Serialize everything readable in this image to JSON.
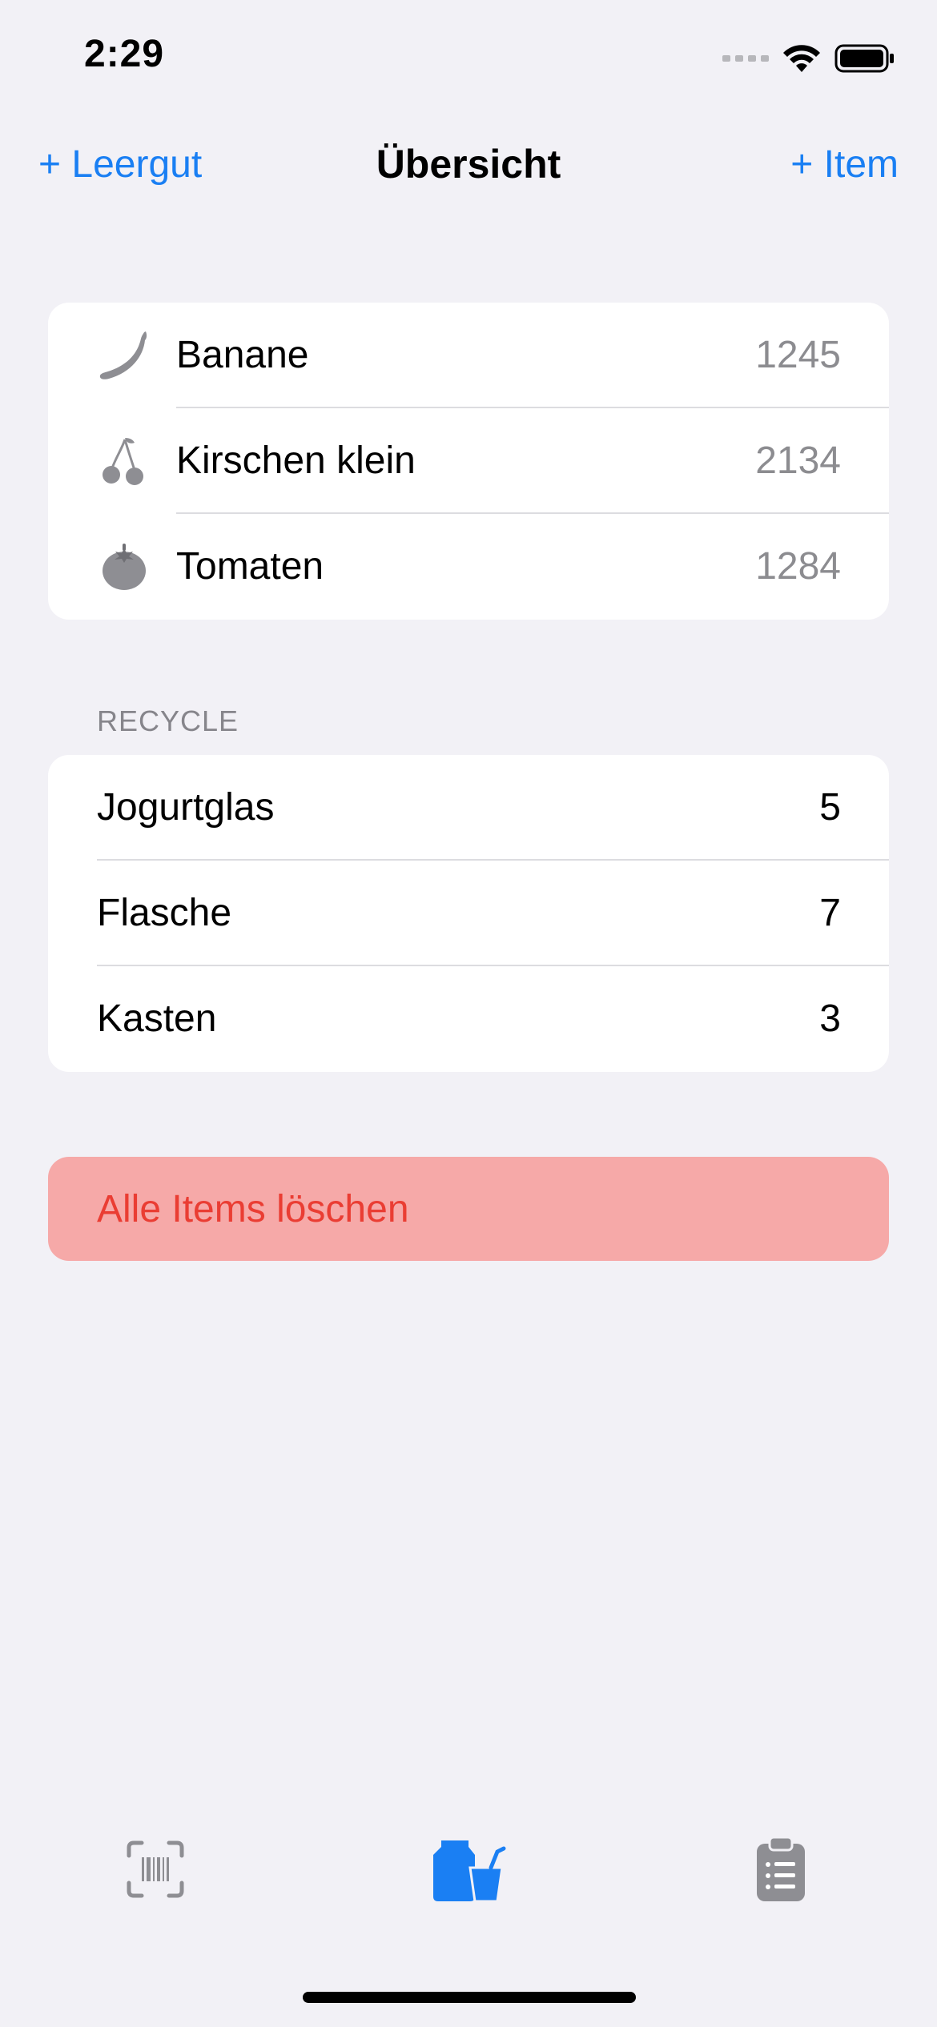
{
  "status_bar": {
    "time": "2:29"
  },
  "nav": {
    "left_button": "+ Leergut",
    "title": "Übersicht",
    "right_button": "+ Item"
  },
  "items": [
    {
      "name": "Banane",
      "code": "1245",
      "icon": "banana-icon"
    },
    {
      "name": "Kirschen klein",
      "code": "2134",
      "icon": "cherries-icon"
    },
    {
      "name": "Tomaten",
      "code": "1284",
      "icon": "tomato-icon"
    }
  ],
  "recycle": {
    "header": "RECYCLE",
    "rows": [
      {
        "name": "Jogurtglas",
        "count": "5"
      },
      {
        "name": "Flasche",
        "count": "7"
      },
      {
        "name": "Kasten",
        "count": "3"
      }
    ]
  },
  "actions": {
    "delete_all": "Alle Items löschen"
  },
  "tabbar": {
    "tabs": [
      {
        "icon": "barcode-scanner-icon",
        "active": false
      },
      {
        "icon": "deposit-containers-icon",
        "active": true
      },
      {
        "icon": "clipboard-list-icon",
        "active": false
      }
    ]
  },
  "colors": {
    "accent": "#1a7ff3",
    "destructive": "#ea3d33",
    "destructive_bg": "#f6a9a8",
    "background": "#f2f1f6",
    "inactive_icon": "#8c8c90"
  }
}
